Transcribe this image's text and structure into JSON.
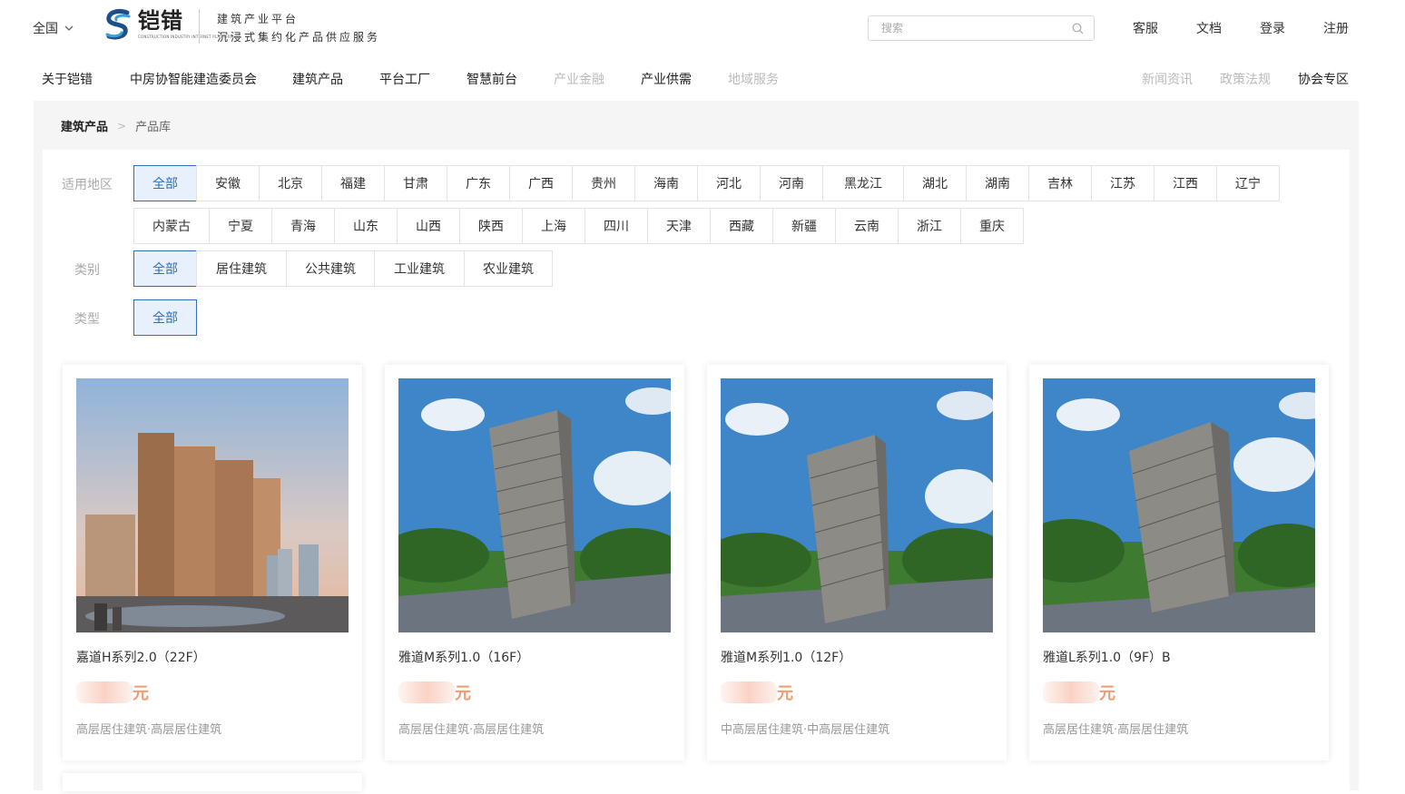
{
  "header": {
    "region": "全国",
    "logo_name": "铠错",
    "logo_en": "CONSTRUCTION INDUSTRY INTERNET PLATFORM",
    "slogan_line1": "建筑产业平台",
    "slogan_line2": "沉浸式集约化产品供应服务",
    "search_placeholder": "搜索",
    "links": [
      "客服",
      "文档",
      "登录",
      "注册"
    ]
  },
  "nav": {
    "items": [
      {
        "label": "关于铠错",
        "dim": false
      },
      {
        "label": "中房协智能建造委员会",
        "dim": false
      },
      {
        "label": "建筑产品",
        "dim": false
      },
      {
        "label": "平台工厂",
        "dim": false
      },
      {
        "label": "智慧前台",
        "dim": false
      },
      {
        "label": "产业金融",
        "dim": true
      },
      {
        "label": "产业供需",
        "dim": false
      },
      {
        "label": "地域服务",
        "dim": true
      }
    ],
    "right_items": [
      {
        "label": "新闻资讯",
        "dim": true
      },
      {
        "label": "政策法规",
        "dim": true
      },
      {
        "label": "协会专区",
        "dim": false
      }
    ]
  },
  "breadcrumb": {
    "root": "建筑产品",
    "separator": ">",
    "current": "产品库"
  },
  "filters": {
    "region_label": "适用地区",
    "regions_row1": [
      "全部",
      "安徽",
      "北京",
      "福建",
      "甘肃",
      "广东",
      "广西",
      "贵州",
      "海南",
      "河北",
      "河南",
      "黑龙江",
      "湖北",
      "湖南",
      "吉林",
      "江苏",
      "江西",
      "辽宁"
    ],
    "regions_row2": [
      "内蒙古",
      "宁夏",
      "青海",
      "山东",
      "山西",
      "陕西",
      "上海",
      "四川",
      "天津",
      "西藏",
      "新疆",
      "云南",
      "浙江",
      "重庆"
    ],
    "category_label": "类别",
    "categories": [
      "全部",
      "居住建筑",
      "公共建筑",
      "工业建筑",
      "农业建筑"
    ],
    "type_label": "类型",
    "types": [
      "全部"
    ]
  },
  "products": [
    {
      "title": "嘉道H系列2.0（22F）",
      "price_unit": "元",
      "tags": "高层居住建筑·高层居住建筑"
    },
    {
      "title": "雅道M系列1.0（16F）",
      "price_unit": "元",
      "tags": "高层居住建筑·高层居住建筑"
    },
    {
      "title": "雅道M系列1.0（12F）",
      "price_unit": "元",
      "tags": "中高层居住建筑·中高层居住建筑"
    },
    {
      "title": "雅道L系列1.0（9F）B",
      "price_unit": "元",
      "tags": "高层居住建筑·高层居住建筑"
    }
  ],
  "colors": {
    "accent": "#2f6fb8",
    "active_bg": "#e8f0fb",
    "price": "#f39a6e"
  }
}
